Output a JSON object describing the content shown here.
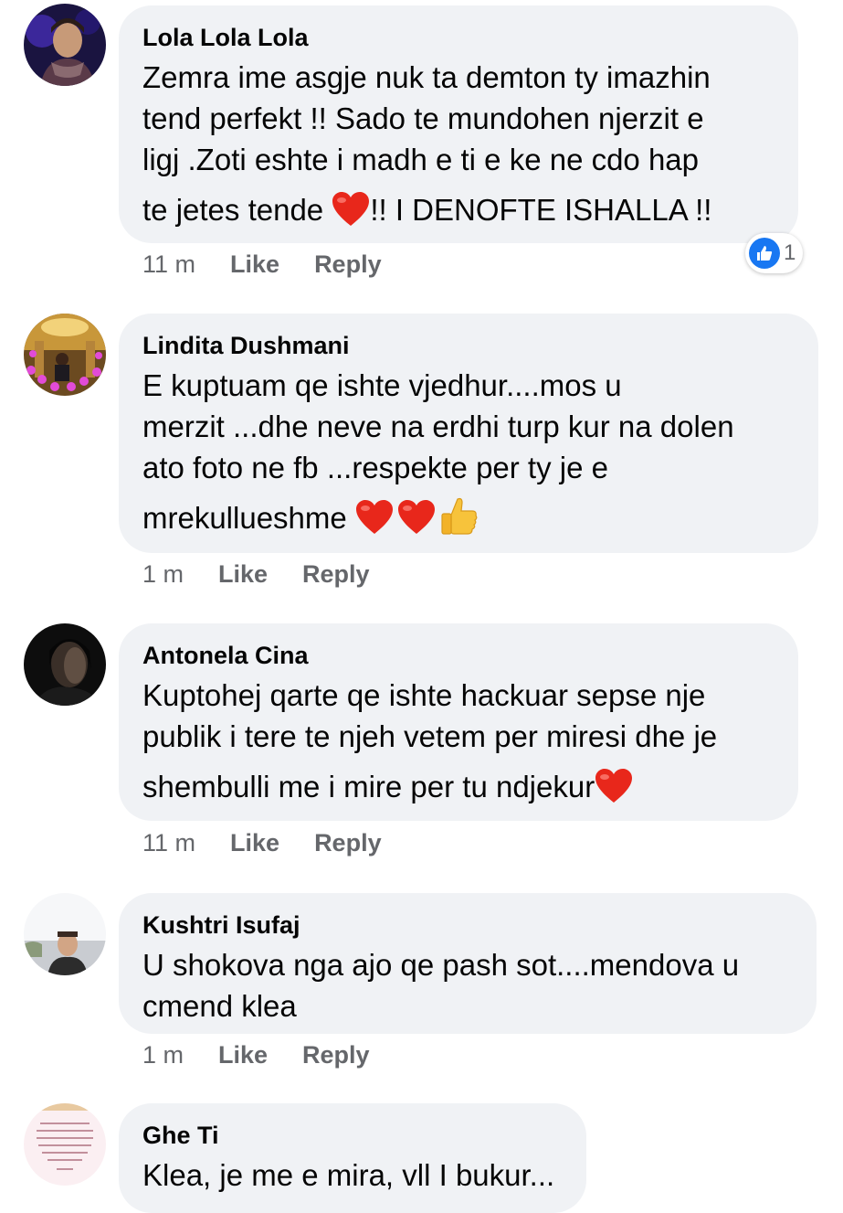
{
  "comments": [
    {
      "author": "Lola Lola Lola",
      "lines": [
        "Zemra ime asgje nuk ta  demton ty imazhin",
        "tend perfekt !! Sado te mundohen njerzit e",
        "ligj  .Zoti eshte i madh e ti e ke ne cdo hap"
      ],
      "last_pre": "te jetes tende ",
      "last_post": "!! I DENOFTE ISHALLA !!",
      "emojis": [
        "red-heart"
      ],
      "time": "11 m",
      "like": "Like",
      "reply": "Reply",
      "reaction_count": "1"
    },
    {
      "author": "Lindita Dushmani",
      "lines": [
        "E kuptuam qe ishte vjedhur....mos u",
        "merzit ...dhe neve na erdhi turp kur na dolen",
        "ato foto ne fb ...respekte per ty je e"
      ],
      "last_pre": "mrekullueshme ",
      "last_post": "",
      "emojis": [
        "red-heart",
        "red-heart",
        "thumbs-up"
      ],
      "time": "1 m",
      "like": "Like",
      "reply": "Reply"
    },
    {
      "author": "Antonela Cina",
      "lines": [
        "Kuptohej qarte qe ishte hackuar sepse nje",
        "publik i tere te njeh vetem per miresi dhe je"
      ],
      "last_pre": "shembulli me i mire per tu ndjekur",
      "last_post": "",
      "emojis": [
        "red-heart"
      ],
      "time": "11 m",
      "like": "Like",
      "reply": "Reply"
    },
    {
      "author": "Kushtri Isufaj",
      "lines": [
        "U shokova nga ajo qe pash sot....mendova u",
        "cmend klea"
      ],
      "time": "1 m",
      "like": "Like",
      "reply": "Reply"
    },
    {
      "author": "Ghe Ti",
      "lines": [
        "Klea, je me e mira, vll I bukur..."
      ]
    }
  ],
  "colors": {
    "bubble": "#f0f2f5",
    "meta": "#65676b",
    "like_blue": "#1877f2",
    "heart": "#e8271b"
  }
}
